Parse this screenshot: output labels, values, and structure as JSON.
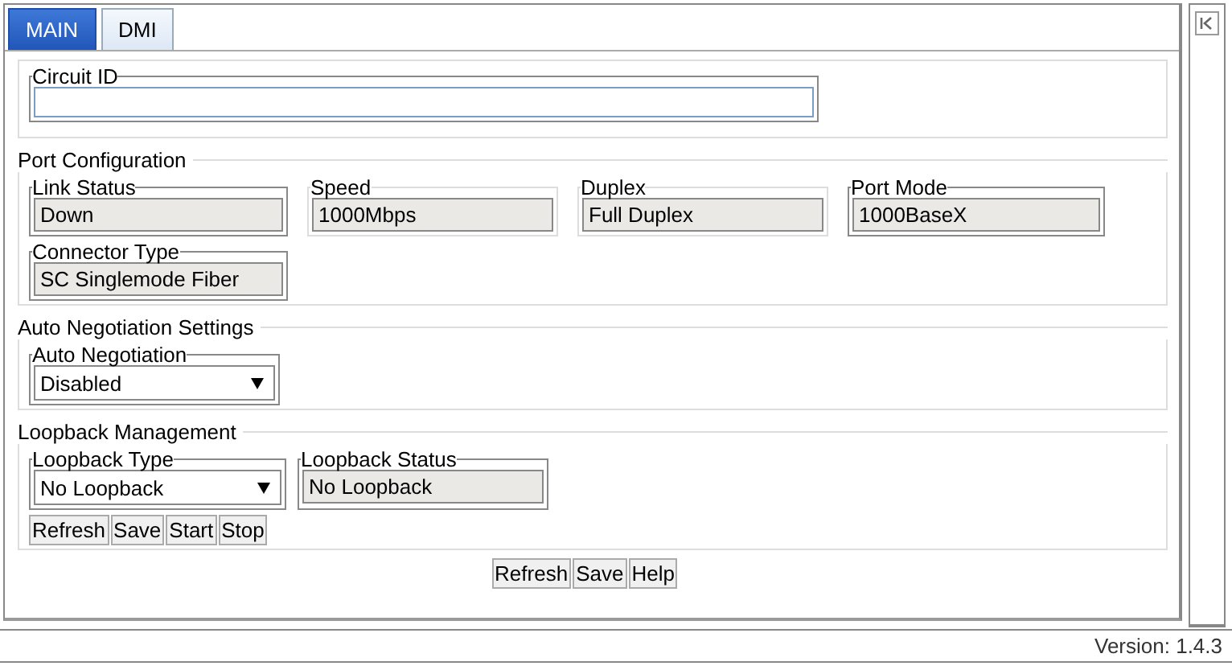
{
  "tabs": [
    {
      "label": "MAIN",
      "selected": true
    },
    {
      "label": "DMI",
      "selected": false
    }
  ],
  "sections": [
    {
      "rows": [
        [
          {
            "label": "Circuit ID",
            "kind": "input",
            "framed": true
          }
        ]
      ]
    },
    {
      "title": "Port Configuration",
      "rows": [
        [
          {
            "label": "Link Status",
            "kind": "readonly",
            "value": "Down",
            "framed": true
          },
          {
            "label": "Speed",
            "kind": "readonly",
            "value": "1000Mbps",
            "framed": false
          },
          {
            "label": "Duplex",
            "kind": "readonly",
            "value": "Full Duplex",
            "framed": false
          },
          {
            "label": "Port Mode",
            "kind": "readonly",
            "value": "1000BaseX",
            "framed": true
          }
        ],
        [
          {
            "label": "Connector Type",
            "kind": "readonly",
            "value": "SC Singlemode Fiber",
            "framed": true
          }
        ]
      ]
    },
    {
      "title": "Auto Negotiation Settings",
      "rows": [
        [
          {
            "label": "Auto Negotiation",
            "kind": "select",
            "value": "Disabled",
            "framed": true
          }
        ]
      ]
    },
    {
      "title": "Loopback Management",
      "rows": [
        [
          {
            "label": "Loopback Type",
            "kind": "select",
            "value": "No Loopback",
            "framed": true
          },
          {
            "label": "Loopback Status",
            "kind": "readonly",
            "value": "No Loopback",
            "framed": true
          }
        ]
      ],
      "buttons": [
        "Refresh",
        "Save",
        "Start",
        "Stop"
      ]
    }
  ],
  "buttons": [
    "Refresh",
    "Save",
    "Help"
  ],
  "version": "Version: 1.4.3"
}
